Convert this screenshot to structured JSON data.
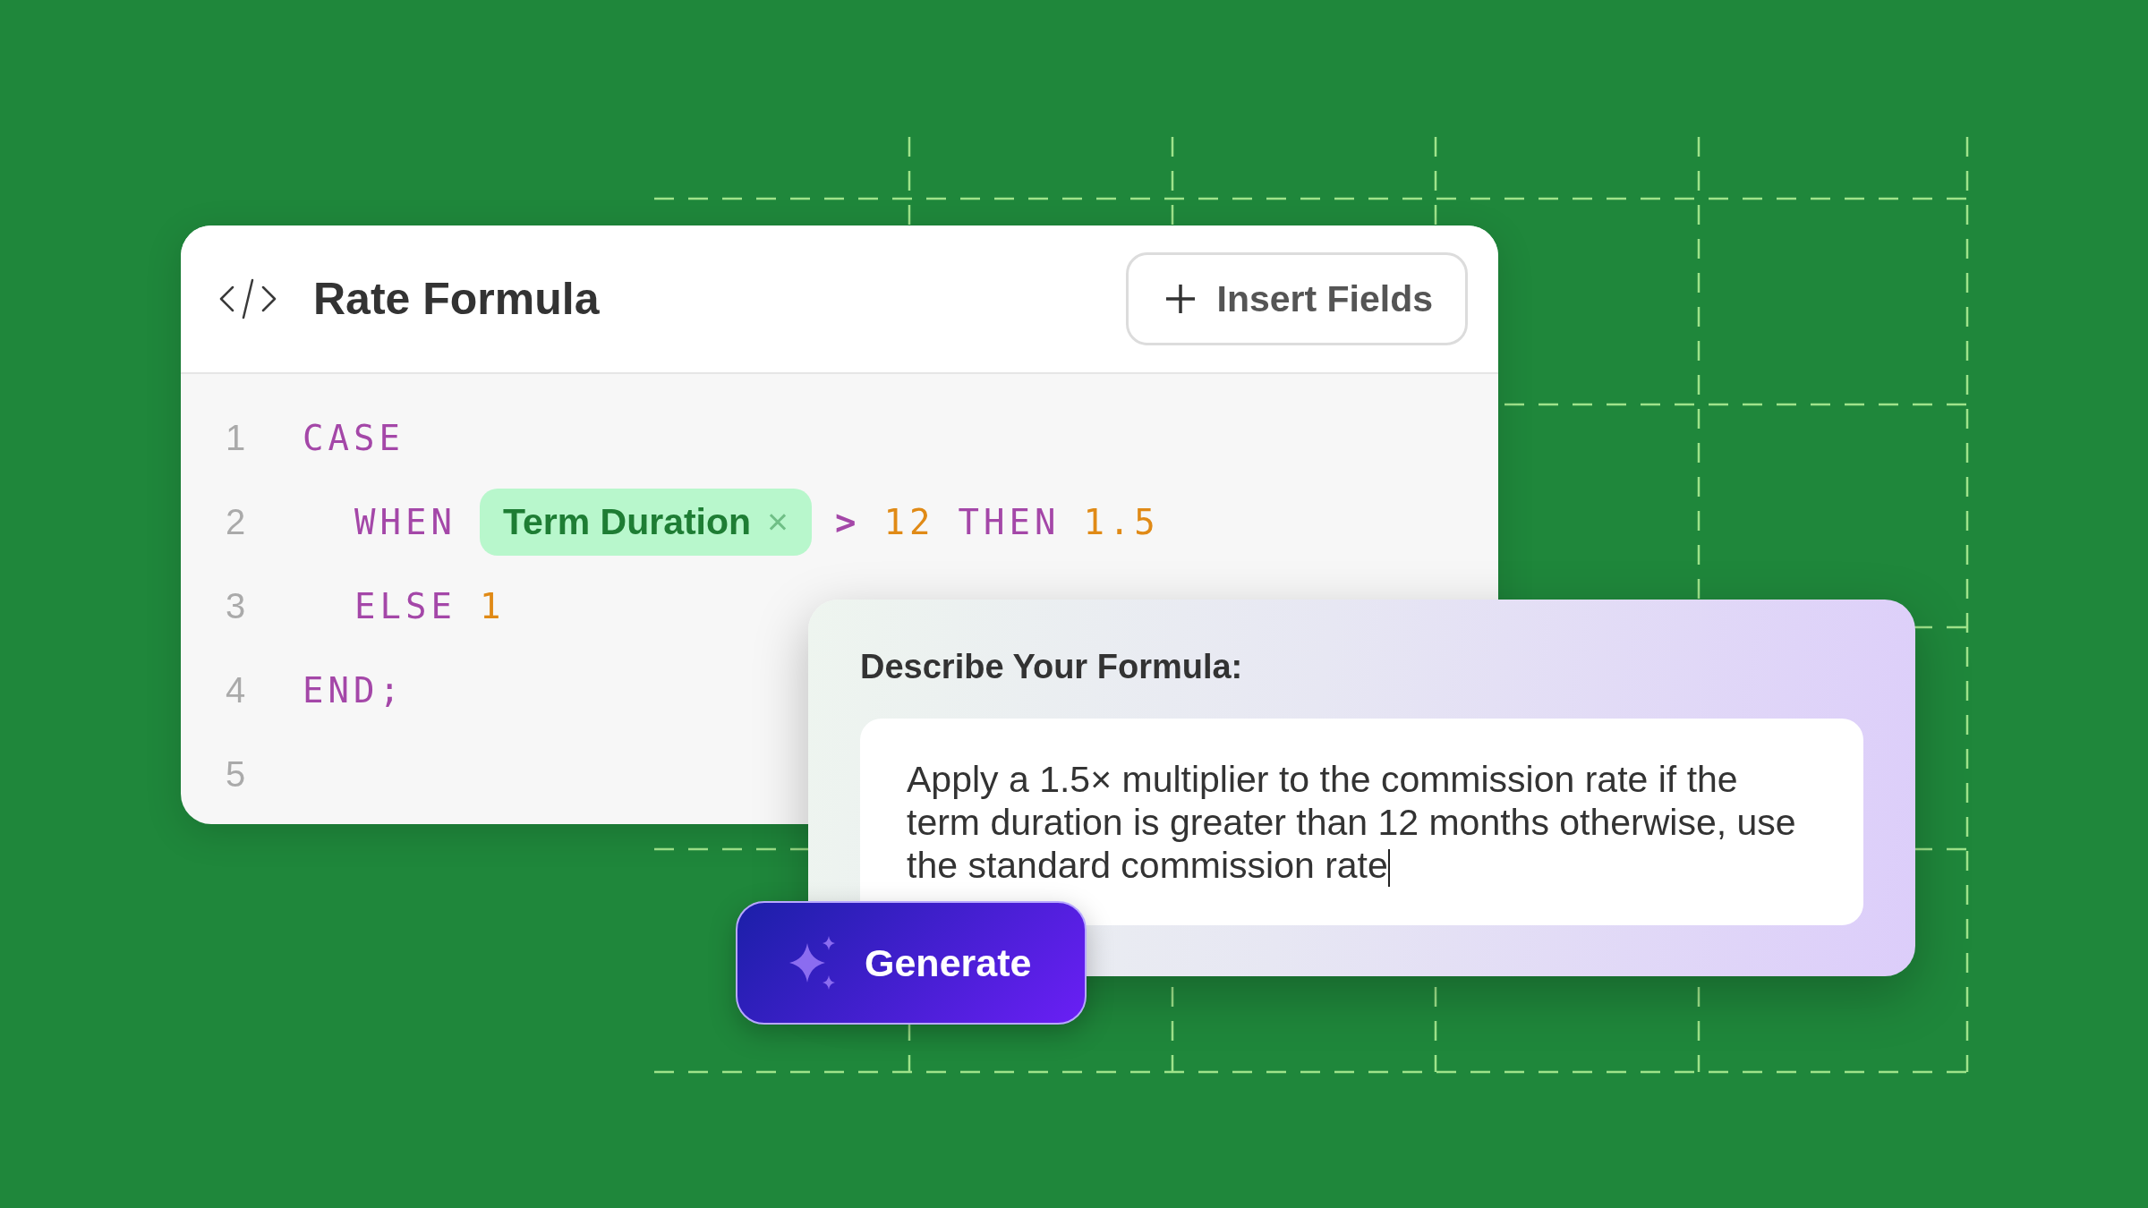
{
  "editor": {
    "title": "Rate Formula",
    "insert_button": "Insert Fields",
    "lines": [
      {
        "number": "1",
        "indented": false,
        "tokens": [
          {
            "kind": "keyword",
            "text": "CASE"
          }
        ]
      },
      {
        "number": "2",
        "indented": true,
        "tokens": [
          {
            "kind": "keyword",
            "text": "WHEN"
          },
          {
            "kind": "field",
            "text": "Term Duration",
            "remove": "×"
          },
          {
            "kind": "operator",
            "text": ">"
          },
          {
            "kind": "number",
            "text": "12"
          },
          {
            "kind": "keyword",
            "text": "THEN"
          },
          {
            "kind": "number",
            "text": "1.5"
          }
        ]
      },
      {
        "number": "3",
        "indented": true,
        "tokens": [
          {
            "kind": "keyword",
            "text": "ELSE"
          },
          {
            "kind": "number",
            "text": "1"
          }
        ]
      },
      {
        "number": "4",
        "indented": false,
        "tokens": [
          {
            "kind": "keyword",
            "text": "END;"
          }
        ]
      },
      {
        "number": "5"
      }
    ]
  },
  "prompt": {
    "label": "Describe Your Formula:",
    "value": "Apply a 1.5× multiplier to the commission rate if the term duration is greater than 12 months otherwise, use the standard commission rate",
    "button": "Generate"
  }
}
